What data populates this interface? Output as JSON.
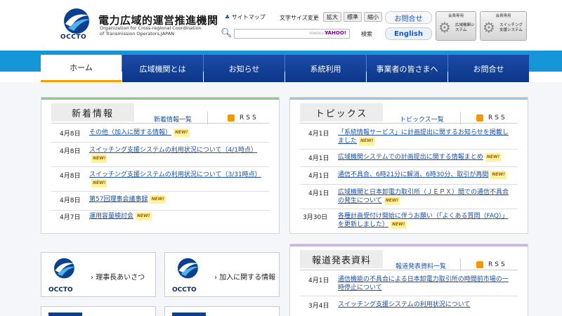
{
  "header": {
    "org_name": "電力広域的運営推進機関",
    "org_name_en": "Organization for Cross-regional Coordination of Transmission Operators,JAPAN",
    "logo_word": "OCCTO",
    "sitemap": "サイトマップ",
    "font_size_label": "文字サイズ変更",
    "font_large": "拡大",
    "font_standard": "標準",
    "font_small": "縮小",
    "contact": "お問合せ",
    "english": "English",
    "member1_header": "会員専用",
    "member1_label": "広域機関システム",
    "member2_header": "会員専用",
    "member2_label": "スイッチング支援システム",
    "search_powered": "POWERED BY",
    "search_engine": "YAHOO!",
    "search_button": "検索"
  },
  "nav": [
    "ホーム",
    "広域機関とは",
    "お知らせ",
    "系統利用",
    "事業者の皆さまへ",
    "お問合せ"
  ],
  "news": {
    "title": "新着情報",
    "list_link": "新着情報一覧",
    "rss": "RSS",
    "items": [
      {
        "date": "4月8日",
        "text": "その他（加入に関する情報）"
      },
      {
        "date": "4月8日",
        "text": "スイッチング支援システムの利用状況について（4/1時点）"
      },
      {
        "date": "4月8日",
        "text": "スイッチング支援システムの利用状況について（3/31時点）"
      },
      {
        "date": "4月8日",
        "text": "第57回理事会議事録"
      },
      {
        "date": "4月7日",
        "text": "運用容量検討会"
      }
    ]
  },
  "topics": {
    "title": "トピックス",
    "list_link": "トピックス一覧",
    "rss": "RSS",
    "items": [
      {
        "date": "4月1日",
        "text": "「系統情報サービス」に計画提出に関するお知らせを掲載しました"
      },
      {
        "date": "4月1日",
        "text": "広域機関システムでの計画提出に関する情報まとめ"
      },
      {
        "date": "4月1日",
        "text": "通信不具合、6時21分に解消、6時30分、取引が再開"
      },
      {
        "date": "4月1日",
        "text": "広域機関と日本卸電力取引所（ＪＥＰＸ）間での通信不具合の発生について"
      },
      {
        "date": "3月30日",
        "text": "各種計画受付け開始に伴うお願い（「よくある質問（FAQ）」を更新しました）"
      }
    ]
  },
  "press": {
    "title": "報道発表資料",
    "list_link": "報道発表資料一覧",
    "rss": "RSS",
    "items": [
      {
        "date": "4月1日",
        "text": "通信機能の不具合による日本卸電力取引所の時間前市場の一時停止について"
      },
      {
        "date": "3月4日",
        "text": "スイッチング支援システムの利用状況について"
      }
    ]
  },
  "quick_links": {
    "greeting": "理事長あいさつ",
    "join_info": "加入に関する情報",
    "logo_word": "OCCTO"
  },
  "new_badge": "NEW!",
  "colors": {
    "nav_blue": "#0c3788",
    "bar_blue": "#1596d8",
    "link_blue": "#1a4fa0",
    "news_stripe": "#8fc98a",
    "topics_stripe": "#9cc4e8",
    "press_stripe": "#c8b6e0"
  }
}
